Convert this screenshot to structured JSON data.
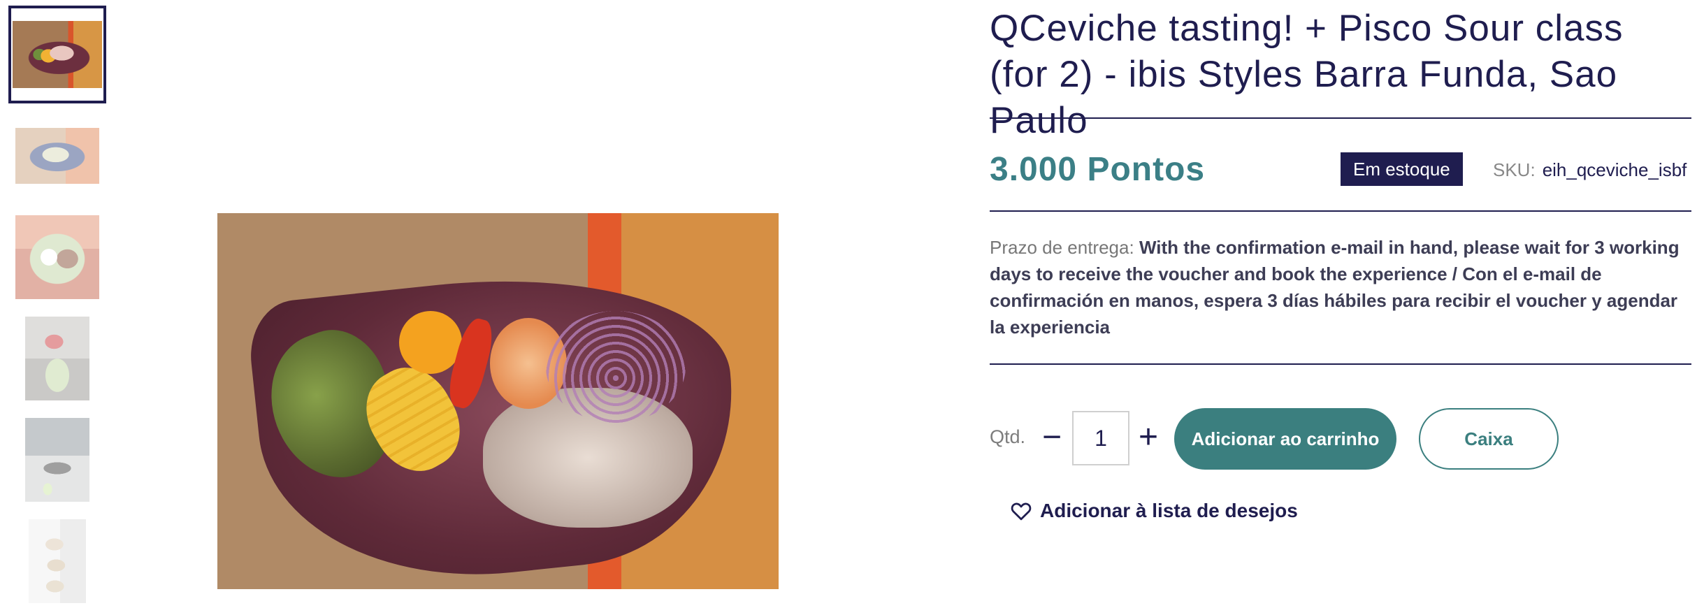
{
  "product": {
    "title": "QCeviche tasting! + Pisco Sour class (for 2) - ibis Styles Barra Funda, Sao Paulo",
    "price": "3.000 Pontos",
    "stock_badge": "Em estoque",
    "sku_label": "SKU:",
    "sku_value": "eih_qceviche_isbf",
    "delivery_label": "Prazo de entrega:",
    "delivery_text": "With the confirmation e-mail in hand, please wait for 3 working days to receive the voucher and book the experience / Con el e-mail de confirmación en manos, espera 3 días hábiles para recibir el voucher y agendar la experiencia"
  },
  "purchase": {
    "qty_label": "Qtd.",
    "qty_value": "1",
    "minus_symbol": "−",
    "plus_symbol": "+",
    "add_to_cart_label": "Adicionar ao carrinho",
    "checkout_label": "Caixa",
    "wishlist_label": "Adicionar à lista de desejos"
  },
  "gallery": {
    "selected_index": 0,
    "thumbnails": [
      "ceviche-plate",
      "ceviche-blue-bowl",
      "rice-plate",
      "pisco-drink",
      "bar-counter",
      "dessert-stack"
    ]
  },
  "colors": {
    "brand_navy": "#1f1d4f",
    "accent_teal": "#3b7f7f",
    "price_teal": "#3b7f86"
  },
  "icons": {
    "wishlist": "heart-icon"
  }
}
